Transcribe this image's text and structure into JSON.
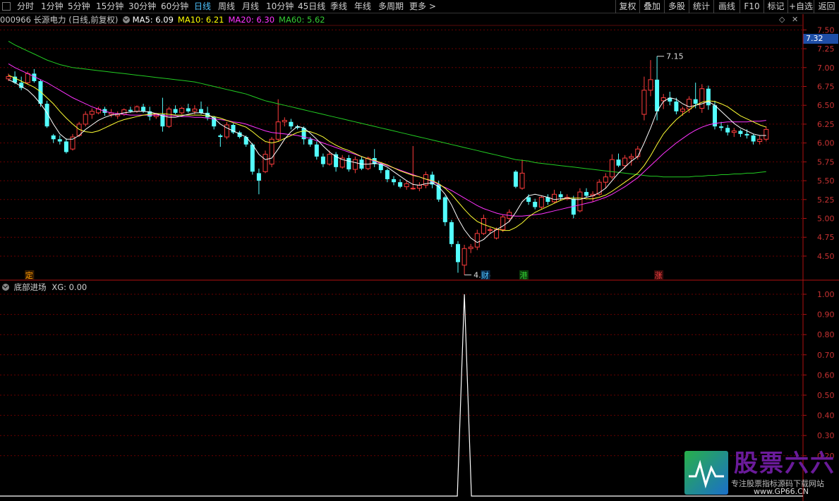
{
  "toolbar": {
    "tabs": [
      "分时",
      "1分钟",
      "5分钟",
      "15分钟",
      "30分钟",
      "60分钟",
      "日线",
      "周线",
      "月线",
      "10分钟",
      "45日线",
      "季线",
      "年线",
      "多周期",
      "更多 >"
    ],
    "active_tab": "日线",
    "right_buttons": [
      "复权",
      "叠加",
      "多股",
      "统计",
      "画线",
      "F10",
      "标记",
      "+自选",
      "返回"
    ]
  },
  "stock": {
    "code": "000966",
    "name": "长源电力",
    "period": "(日线,前复权)"
  },
  "indicators": [
    {
      "label": "MA5: 6.09",
      "color": "#ffffff"
    },
    {
      "label": "MA10: 6.21",
      "color": "#ffff00"
    },
    {
      "label": "MA20: 6.30",
      "color": "#ff33ff"
    },
    {
      "label": "MA60: 5.62",
      "color": "#33cc33"
    }
  ],
  "current_price": "7.32",
  "price_axis": {
    "ticks": [
      "7.50",
      "7.25",
      "7.00",
      "6.75",
      "6.50",
      "6.25",
      "6.00",
      "5.75",
      "5.50",
      "5.25",
      "5.00",
      "4.75",
      "4.50"
    ]
  },
  "annotations": {
    "high_label": "7.15",
    "low_label": "4.25",
    "markers": [
      {
        "text": "定",
        "color": "#ff9900",
        "bg": "#3a1f00"
      },
      {
        "text": "财",
        "color": "#4ec3ff",
        "bg": "#0a2a4a"
      },
      {
        "text": "港",
        "color": "#33cc33",
        "bg": "#0a3a0a"
      },
      {
        "text": "涨",
        "color": "#ff4444",
        "bg": "#3a0a0a"
      }
    ]
  },
  "sub_indicator": {
    "name": "底部进场",
    "value_label": "XG: 0.00",
    "axis_ticks": [
      "1.00",
      "0.90",
      "0.80",
      "0.70",
      "0.60",
      "0.50",
      "0.40",
      "0.30",
      "0.20"
    ]
  },
  "chart_data": {
    "type": "candlestick",
    "y_range": [
      4.2,
      7.55
    ],
    "candles": [
      [
        6.85,
        6.92,
        6.82,
        6.88
      ],
      [
        6.88,
        6.95,
        6.78,
        6.8
      ],
      [
        6.8,
        6.88,
        6.7,
        6.73
      ],
      [
        6.8,
        6.95,
        6.78,
        6.92
      ],
      [
        6.92,
        6.98,
        6.8,
        6.82
      ],
      [
        6.82,
        6.84,
        6.48,
        6.52
      ],
      [
        6.52,
        6.56,
        6.2,
        6.22
      ],
      [
        6.1,
        6.12,
        6.0,
        6.05
      ],
      [
        6.05,
        6.1,
        5.98,
        6.02
      ],
      [
        6.02,
        6.06,
        5.86,
        5.88
      ],
      [
        5.92,
        6.12,
        5.9,
        6.08
      ],
      [
        6.1,
        6.28,
        6.08,
        6.25
      ],
      [
        6.25,
        6.42,
        6.22,
        6.38
      ],
      [
        6.38,
        6.46,
        6.32,
        6.42
      ],
      [
        6.4,
        6.48,
        6.38,
        6.45
      ],
      [
        6.45,
        6.48,
        6.36,
        6.4
      ],
      [
        6.38,
        6.45,
        6.34,
        6.4
      ],
      [
        6.36,
        6.42,
        6.32,
        6.38
      ],
      [
        6.38,
        6.46,
        6.36,
        6.44
      ],
      [
        6.44,
        6.48,
        6.4,
        6.42
      ],
      [
        6.42,
        6.5,
        6.4,
        6.48
      ],
      [
        6.48,
        6.52,
        6.4,
        6.42
      ],
      [
        6.42,
        6.48,
        6.3,
        6.35
      ],
      [
        6.35,
        6.4,
        6.32,
        6.38
      ],
      [
        6.38,
        6.6,
        6.15,
        6.22
      ],
      [
        6.22,
        6.48,
        6.2,
        6.45
      ],
      [
        6.45,
        6.5,
        6.38,
        6.4
      ],
      [
        6.4,
        6.48,
        6.38,
        6.46
      ],
      [
        6.46,
        6.52,
        6.4,
        6.42
      ],
      [
        6.42,
        6.5,
        6.38,
        6.45
      ],
      [
        6.45,
        6.55,
        6.38,
        6.4
      ],
      [
        6.4,
        6.48,
        6.3,
        6.34
      ],
      [
        6.34,
        6.36,
        6.18,
        6.22
      ],
      [
        6.1,
        6.12,
        5.95,
        6.08
      ],
      [
        6.08,
        6.28,
        6.05,
        6.24
      ],
      [
        6.24,
        6.26,
        6.12,
        6.14
      ],
      [
        6.14,
        6.16,
        6.06,
        6.08
      ],
      [
        6.08,
        6.1,
        5.95,
        5.98
      ],
      [
        5.98,
        6.0,
        5.58,
        5.62
      ],
      [
        5.6,
        5.66,
        5.32,
        5.5
      ],
      [
        5.62,
        5.9,
        5.6,
        5.85
      ],
      [
        5.72,
        6.08,
        5.68,
        6.05
      ],
      [
        6.05,
        6.58,
        6.02,
        6.28
      ],
      [
        6.28,
        6.34,
        6.22,
        6.3
      ],
      [
        6.28,
        6.32,
        6.18,
        6.22
      ],
      [
        6.22,
        6.24,
        6.18,
        6.2
      ],
      [
        6.2,
        6.22,
        5.98,
        6.05
      ],
      [
        6.05,
        6.08,
        5.95,
        5.98
      ],
      [
        5.98,
        6.02,
        5.78,
        5.82
      ],
      [
        5.82,
        5.86,
        5.68,
        5.72
      ],
      [
        5.72,
        5.9,
        5.7,
        5.85
      ],
      [
        5.85,
        5.88,
        5.62,
        5.68
      ],
      [
        5.68,
        5.84,
        5.66,
        5.8
      ],
      [
        5.8,
        5.84,
        5.62,
        5.65
      ],
      [
        5.65,
        5.82,
        5.6,
        5.78
      ],
      [
        5.78,
        5.82,
        5.64,
        5.66
      ],
      [
        5.66,
        5.82,
        5.64,
        5.8
      ],
      [
        5.8,
        5.92,
        5.68,
        5.72
      ],
      [
        5.72,
        5.74,
        5.6,
        5.64
      ],
      [
        5.64,
        5.66,
        5.48,
        5.52
      ],
      [
        5.52,
        5.56,
        5.44,
        5.48
      ],
      [
        5.48,
        5.52,
        5.4,
        5.42
      ],
      [
        5.42,
        5.5,
        5.38,
        5.46
      ],
      [
        5.4,
        5.96,
        5.38,
        5.4
      ],
      [
        5.4,
        5.48,
        5.36,
        5.44
      ],
      [
        5.44,
        5.62,
        5.4,
        5.58
      ],
      [
        5.58,
        5.62,
        5.4,
        5.45
      ],
      [
        5.45,
        5.5,
        5.22,
        5.25
      ],
      [
        5.28,
        5.3,
        4.9,
        4.95
      ],
      [
        4.95,
        4.98,
        4.62,
        4.66
      ],
      [
        4.66,
        4.7,
        4.28,
        4.42
      ],
      [
        4.38,
        4.65,
        4.25,
        4.6
      ],
      [
        4.6,
        4.66,
        4.54,
        4.62
      ],
      [
        4.62,
        4.85,
        4.58,
        4.8
      ],
      [
        4.8,
        5.05,
        4.78,
        5.0
      ],
      [
        4.84,
        4.88,
        4.8,
        4.85
      ],
      [
        4.74,
        4.88,
        4.72,
        4.85
      ],
      [
        4.85,
        5.05,
        4.82,
        5.02
      ],
      [
        5.0,
        5.12,
        4.95,
        5.08
      ],
      [
        5.62,
        5.64,
        5.4,
        5.42
      ],
      [
        5.4,
        5.78,
        5.38,
        5.6
      ],
      [
        5.28,
        5.32,
        5.18,
        5.22
      ],
      [
        5.22,
        5.26,
        5.12,
        5.15
      ],
      [
        5.15,
        5.3,
        5.12,
        5.28
      ],
      [
        5.28,
        5.32,
        5.18,
        5.22
      ],
      [
        5.22,
        5.38,
        5.2,
        5.32
      ],
      [
        5.32,
        5.36,
        5.24,
        5.28
      ],
      [
        5.26,
        5.32,
        5.24,
        5.28
      ],
      [
        5.26,
        5.3,
        5.0,
        5.05
      ],
      [
        5.1,
        5.4,
        5.08,
        5.35
      ],
      [
        5.35,
        5.4,
        5.28,
        5.3
      ],
      [
        5.3,
        5.36,
        5.22,
        5.32
      ],
      [
        5.32,
        5.52,
        5.3,
        5.48
      ],
      [
        5.48,
        5.6,
        5.4,
        5.55
      ],
      [
        5.55,
        5.85,
        5.52,
        5.78
      ],
      [
        5.78,
        5.86,
        5.68,
        5.7
      ],
      [
        5.7,
        5.84,
        5.66,
        5.8
      ],
      [
        5.8,
        5.86,
        5.7,
        5.82
      ],
      [
        5.82,
        5.96,
        5.78,
        5.92
      ],
      [
        6.38,
        6.88,
        6.3,
        6.7
      ],
      [
        6.7,
        7.1,
        6.62,
        6.84
      ],
      [
        6.84,
        7.15,
        6.3,
        6.42
      ],
      [
        6.56,
        6.65,
        6.45,
        6.6
      ],
      [
        6.6,
        6.68,
        6.5,
        6.55
      ],
      [
        6.55,
        6.6,
        6.38,
        6.42
      ],
      [
        6.42,
        6.48,
        6.36,
        6.45
      ],
      [
        6.45,
        6.62,
        6.4,
        6.58
      ],
      [
        6.58,
        6.8,
        6.46,
        6.52
      ],
      [
        6.46,
        6.78,
        6.4,
        6.72
      ],
      [
        6.72,
        6.76,
        6.44,
        6.5
      ],
      [
        6.5,
        6.56,
        6.18,
        6.22
      ],
      [
        6.22,
        6.28,
        6.16,
        6.2
      ],
      [
        6.2,
        6.24,
        6.1,
        6.14
      ],
      [
        6.14,
        6.2,
        6.08,
        6.16
      ],
      [
        6.16,
        6.18,
        6.08,
        6.12
      ],
      [
        6.12,
        6.18,
        6.06,
        6.1
      ],
      [
        6.1,
        6.12,
        5.98,
        6.02
      ],
      [
        6.02,
        6.1,
        5.98,
        6.05
      ],
      [
        6.05,
        6.22,
        6.02,
        6.18
      ]
    ],
    "ma5": [
      6.84,
      6.8,
      6.75,
      6.7,
      6.62,
      6.52,
      6.4,
      6.25,
      6.12,
      6.05,
      6.05,
      6.1,
      6.18,
      6.24,
      6.3,
      6.34,
      6.37,
      6.38,
      6.4,
      6.41,
      6.42,
      6.42,
      6.41,
      6.39,
      6.36,
      6.34,
      6.34,
      6.36,
      6.38,
      6.4,
      6.4,
      6.38,
      6.33,
      6.25,
      6.2,
      6.16,
      6.12,
      6.08,
      5.98,
      5.85,
      5.78,
      5.8,
      5.92,
      6.05,
      6.15,
      6.22,
      6.2,
      6.13,
      6.05,
      5.96,
      5.88,
      5.82,
      5.78,
      5.76,
      5.74,
      5.72,
      5.72,
      5.73,
      5.72,
      5.68,
      5.62,
      5.56,
      5.5,
      5.45,
      5.44,
      5.46,
      5.47,
      5.42,
      5.32,
      5.18,
      5.0,
      4.85,
      4.74,
      4.68,
      4.72,
      4.8,
      4.85,
      4.9,
      4.96,
      5.08,
      5.22,
      5.3,
      5.32,
      5.3,
      5.28,
      5.25,
      5.26,
      5.27,
      5.25,
      5.25,
      5.28,
      5.3,
      5.34,
      5.4,
      5.5,
      5.6,
      5.68,
      5.76,
      5.82,
      6.0,
      6.2,
      6.42,
      6.55,
      6.6,
      6.58,
      6.52,
      6.48,
      6.5,
      6.52,
      6.55,
      6.5,
      6.42,
      6.34,
      6.26,
      6.2,
      6.16,
      6.12,
      6.1,
      6.1
    ],
    "ma10": [
      6.9,
      6.86,
      6.82,
      6.78,
      6.74,
      6.68,
      6.6,
      6.52,
      6.42,
      6.33,
      6.25,
      6.18,
      6.15,
      6.14,
      6.16,
      6.2,
      6.24,
      6.28,
      6.31,
      6.33,
      6.35,
      6.37,
      6.38,
      6.39,
      6.39,
      6.38,
      6.37,
      6.37,
      6.37,
      6.37,
      6.37,
      6.36,
      6.35,
      6.33,
      6.3,
      6.27,
      6.24,
      6.21,
      6.15,
      6.08,
      6.02,
      6.0,
      6.02,
      6.06,
      6.1,
      6.14,
      6.16,
      6.15,
      6.12,
      6.08,
      6.02,
      5.97,
      5.93,
      5.9,
      5.86,
      5.82,
      5.79,
      5.77,
      5.74,
      5.71,
      5.67,
      5.63,
      5.6,
      5.57,
      5.55,
      5.52,
      5.5,
      5.46,
      5.4,
      5.32,
      5.22,
      5.12,
      5.03,
      4.96,
      4.92,
      4.89,
      4.86,
      4.84,
      4.84,
      4.88,
      4.94,
      5.02,
      5.08,
      5.12,
      5.16,
      5.2,
      5.24,
      5.27,
      5.27,
      5.27,
      5.26,
      5.26,
      5.28,
      5.31,
      5.36,
      5.42,
      5.48,
      5.54,
      5.6,
      5.7,
      5.83,
      5.98,
      6.12,
      6.22,
      6.31,
      6.38,
      6.44,
      6.5,
      6.54,
      6.56,
      6.55,
      6.52,
      6.48,
      6.42,
      6.36,
      6.32,
      6.28,
      6.24,
      6.21
    ],
    "ma20": [
      7.05,
      7.0,
      6.96,
      6.92,
      6.88,
      6.84,
      6.8,
      6.75,
      6.7,
      6.65,
      6.6,
      6.56,
      6.52,
      6.48,
      6.45,
      6.42,
      6.4,
      6.39,
      6.38,
      6.37,
      6.37,
      6.37,
      6.37,
      6.37,
      6.37,
      6.36,
      6.36,
      6.35,
      6.35,
      6.34,
      6.34,
      6.33,
      6.32,
      6.31,
      6.3,
      6.28,
      6.27,
      6.25,
      6.22,
      6.19,
      6.16,
      6.14,
      6.13,
      6.12,
      6.11,
      6.1,
      6.08,
      6.06,
      6.03,
      6.0,
      5.97,
      5.94,
      5.91,
      5.88,
      5.85,
      5.82,
      5.79,
      5.76,
      5.73,
      5.7,
      5.67,
      5.64,
      5.61,
      5.58,
      5.55,
      5.52,
      5.49,
      5.45,
      5.41,
      5.37,
      5.32,
      5.27,
      5.22,
      5.17,
      5.13,
      5.1,
      5.07,
      5.05,
      5.04,
      5.03,
      5.03,
      5.04,
      5.05,
      5.06,
      5.08,
      5.1,
      5.12,
      5.14,
      5.16,
      5.18,
      5.2,
      5.22,
      5.25,
      5.28,
      5.32,
      5.37,
      5.42,
      5.48,
      5.54,
      5.62,
      5.7,
      5.78,
      5.86,
      5.93,
      6.0,
      6.06,
      6.12,
      6.17,
      6.21,
      6.24,
      6.26,
      6.27,
      6.28,
      6.28,
      6.28,
      6.28,
      6.29,
      6.29,
      6.3
    ],
    "ma60": [
      7.35,
      7.3,
      7.26,
      7.22,
      7.18,
      7.14,
      7.1,
      7.07,
      7.04,
      7.02,
      7.0,
      6.99,
      6.98,
      6.97,
      6.96,
      6.95,
      6.94,
      6.93,
      6.92,
      6.91,
      6.9,
      6.89,
      6.88,
      6.87,
      6.86,
      6.85,
      6.84,
      6.83,
      6.82,
      6.81,
      6.79,
      6.77,
      6.75,
      6.73,
      6.71,
      6.69,
      6.67,
      6.65,
      6.62,
      6.59,
      6.56,
      6.54,
      6.52,
      6.5,
      6.48,
      6.46,
      6.44,
      6.42,
      6.4,
      6.38,
      6.36,
      6.34,
      6.32,
      6.3,
      6.28,
      6.26,
      6.24,
      6.22,
      6.2,
      6.18,
      6.16,
      6.14,
      6.12,
      6.1,
      6.08,
      6.06,
      6.04,
      6.02,
      6.0,
      5.98,
      5.96,
      5.94,
      5.92,
      5.9,
      5.88,
      5.86,
      5.84,
      5.82,
      5.8,
      5.78,
      5.77,
      5.76,
      5.74,
      5.73,
      5.72,
      5.71,
      5.7,
      5.69,
      5.68,
      5.67,
      5.66,
      5.65,
      5.64,
      5.63,
      5.62,
      5.61,
      5.6,
      5.59,
      5.58,
      5.57,
      5.56,
      5.56,
      5.55,
      5.55,
      5.55,
      5.55,
      5.55,
      5.56,
      5.56,
      5.57,
      5.57,
      5.58,
      5.58,
      5.59,
      5.59,
      5.6,
      5.6,
      5.61,
      5.62
    ],
    "xg_signal_index": 71
  },
  "logo": {
    "brand": "股票六六",
    "slogan": "专注股票指标源码下载网站",
    "url": "www.GP66.CN"
  }
}
